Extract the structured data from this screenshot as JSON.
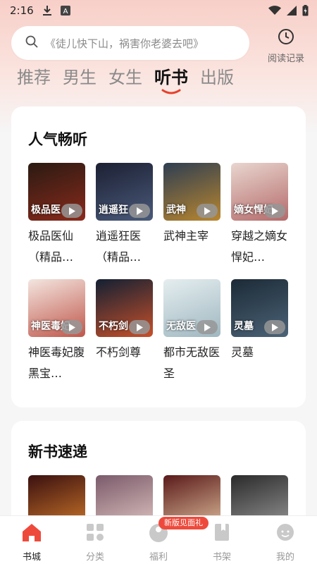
{
  "status_bar": {
    "time": "2:16",
    "icons": [
      "download-icon",
      "keyboard-a-icon",
      "wifi-icon",
      "signal-icon",
      "battery-icon"
    ]
  },
  "search": {
    "placeholder": "《徒儿快下山，祸害你老婆去吧》"
  },
  "history": {
    "label": "阅读记录",
    "icon": "clock-icon"
  },
  "category_tabs": [
    {
      "label": "推荐",
      "active": false
    },
    {
      "label": "男生",
      "active": false
    },
    {
      "label": "女生",
      "active": false
    },
    {
      "label": "听书",
      "active": true
    },
    {
      "label": "出版",
      "active": false
    }
  ],
  "popular": {
    "title": "人气畅听",
    "books": [
      {
        "title": "极品医仙（精品…",
        "cover_text": "极品医",
        "colors": [
          "#2a1a12",
          "#8a2a1c"
        ]
      },
      {
        "title": "逍遥狂医（精品…",
        "cover_text": "逍遥狂",
        "colors": [
          "#1c2033",
          "#4a5a7a"
        ]
      },
      {
        "title": "武神主宰",
        "cover_text": "武神",
        "colors": [
          "#2e3e52",
          "#b9862e"
        ]
      },
      {
        "title": "穿越之嫡女悍妃…",
        "cover_text": "嫡女悍妃",
        "colors": [
          "#e9d6cf",
          "#b46a6a"
        ]
      },
      {
        "title": "神医毒妃腹黑宝…",
        "cover_text": "神医毒妃",
        "colors": [
          "#f3e6e0",
          "#c0574b"
        ]
      },
      {
        "title": "不朽剑尊",
        "cover_text": "不朽剑",
        "colors": [
          "#122033",
          "#c7502a"
        ]
      },
      {
        "title": "都市无敌医圣",
        "cover_text": "无敌医",
        "colors": [
          "#e5eef0",
          "#9fb7c0"
        ]
      },
      {
        "title": "灵墓",
        "cover_text": "灵墓",
        "colors": [
          "#1c2a36",
          "#4b6377"
        ]
      }
    ]
  },
  "new_books": {
    "title": "新书速递",
    "books": [
      {
        "colors": [
          "#3a1010",
          "#d27a2a"
        ]
      },
      {
        "colors": [
          "#7a5a6a",
          "#e4c9c5"
        ]
      },
      {
        "colors": [
          "#5a1a1a",
          "#e3c3a0"
        ]
      },
      {
        "colors": [
          "#2a2a2a",
          "#9a9a9a"
        ]
      }
    ]
  },
  "bottom_nav": [
    {
      "label": "书城",
      "icon": "home-icon",
      "active": true
    },
    {
      "label": "分类",
      "icon": "grid-icon",
      "active": false
    },
    {
      "label": "福利",
      "icon": "gift-icon",
      "active": false
    },
    {
      "label": "书架",
      "icon": "bookshelf-icon",
      "active": false
    },
    {
      "label": "我的",
      "icon": "profile-icon",
      "active": false
    }
  ],
  "welfare_badge": "新版见面礼",
  "colors": {
    "accent": "#ee4a3c",
    "tab_underline": "#e8412c",
    "nav_active": "#ee4a3c"
  }
}
